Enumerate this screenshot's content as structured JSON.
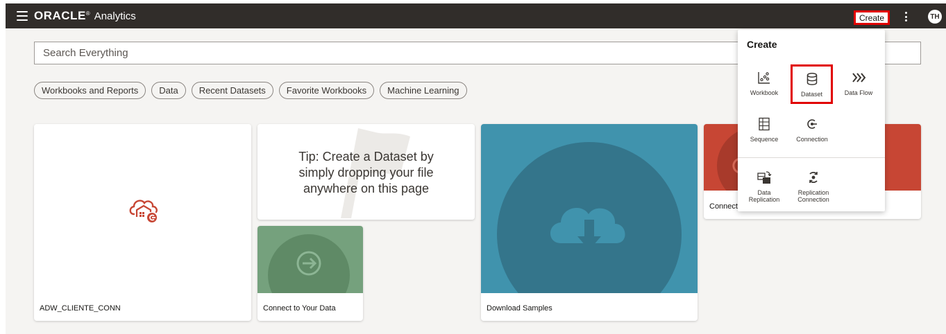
{
  "topbar": {
    "brand_oracle": "ORACLE",
    "brand_reg": "®",
    "brand_product": "Analytics",
    "create_label": "Create",
    "avatar_initials": "TH",
    "bg_color": "#312d2a",
    "highlight_color": "#e10000"
  },
  "search": {
    "placeholder": "Search Everything"
  },
  "chips": [
    {
      "label": "Workbooks and Reports"
    },
    {
      "label": "Data"
    },
    {
      "label": "Recent Datasets"
    },
    {
      "label": "Favorite Workbooks"
    },
    {
      "label": "Machine Learning"
    }
  ],
  "cards": {
    "adw": {
      "label": "ADW_CLIENTE_CONN",
      "icon": "cloud-warehouse-connection-icon",
      "accent": "#c74634"
    },
    "tip": {
      "text": "Tip: Create a Dataset by simply dropping your file anywhere on this page",
      "icon": "flag-icon"
    },
    "connect": {
      "label": "Connect to Your Data",
      "color": "#75a17d",
      "icon": "arrow-right-circle-icon"
    },
    "download": {
      "label": "Download Samples",
      "color": "#4093ad",
      "icon": "cloud-download-icon"
    },
    "red": {
      "label": "Connect",
      "color": "#c74634"
    }
  },
  "create_menu": {
    "title": "Create",
    "items": [
      {
        "label": "Workbook",
        "icon": "workbook-icon"
      },
      {
        "label": "Dataset",
        "icon": "database-icon",
        "selected": true
      },
      {
        "label": "Data Flow",
        "icon": "data-flow-icon"
      },
      {
        "label": "Sequence",
        "icon": "sequence-icon"
      },
      {
        "label": "Connection",
        "icon": "connection-icon"
      },
      {
        "label": "Data Replication",
        "icon": "data-replication-icon"
      },
      {
        "label": "Replication Connection",
        "icon": "replication-connection-icon"
      }
    ]
  }
}
